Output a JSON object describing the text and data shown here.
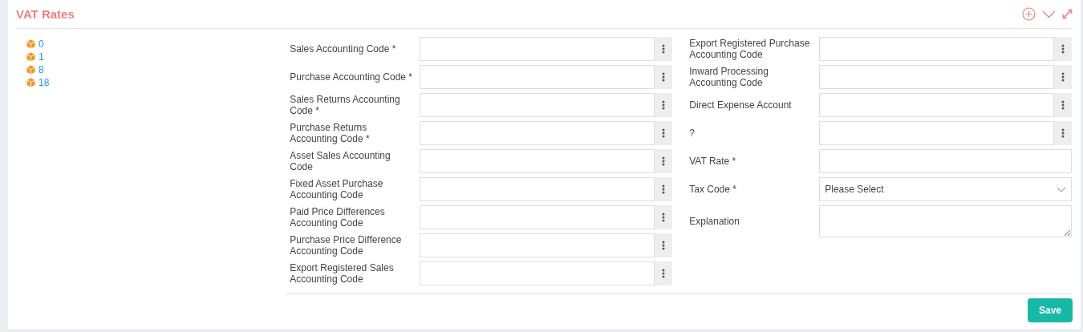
{
  "panel": {
    "title": "VAT Rates"
  },
  "tree": [
    {
      "label": "0"
    },
    {
      "label": "1"
    },
    {
      "label": "8"
    },
    {
      "label": "18"
    }
  ],
  "form_left": [
    {
      "label": "Sales Accounting Code *",
      "kind": "lookup"
    },
    {
      "label": "Purchase Accounting Code *",
      "kind": "lookup"
    },
    {
      "label": "Sales Returns Accounting Code *",
      "kind": "lookup"
    },
    {
      "label": "Purchase Returns Accounting Code *",
      "kind": "lookup"
    },
    {
      "label": "Asset Sales Accounting Code",
      "kind": "lookup"
    },
    {
      "label": "Fixed Asset Purchase Accounting Code",
      "kind": "lookup"
    },
    {
      "label": "Paid Price Differences Accounting Code",
      "kind": "lookup"
    },
    {
      "label": "Purchase Price Difference Accounting Code",
      "kind": "lookup"
    },
    {
      "label": "Export Registered Sales Accounting Code",
      "kind": "lookup"
    }
  ],
  "form_right": [
    {
      "label": "Export Registered Purchase Accounting Code",
      "kind": "lookup"
    },
    {
      "label": "Inward Processing Accounting Code",
      "kind": "lookup"
    },
    {
      "label": "Direct Expense Account",
      "kind": "lookup"
    },
    {
      "label": "?",
      "kind": "lookup"
    },
    {
      "label": "VAT Rate *",
      "kind": "text"
    },
    {
      "label": "Tax Code *",
      "kind": "select",
      "value": "Please Select"
    },
    {
      "label": "Explanation",
      "kind": "textarea"
    }
  ],
  "buttons": [
    {
      "label": "Save"
    }
  ]
}
